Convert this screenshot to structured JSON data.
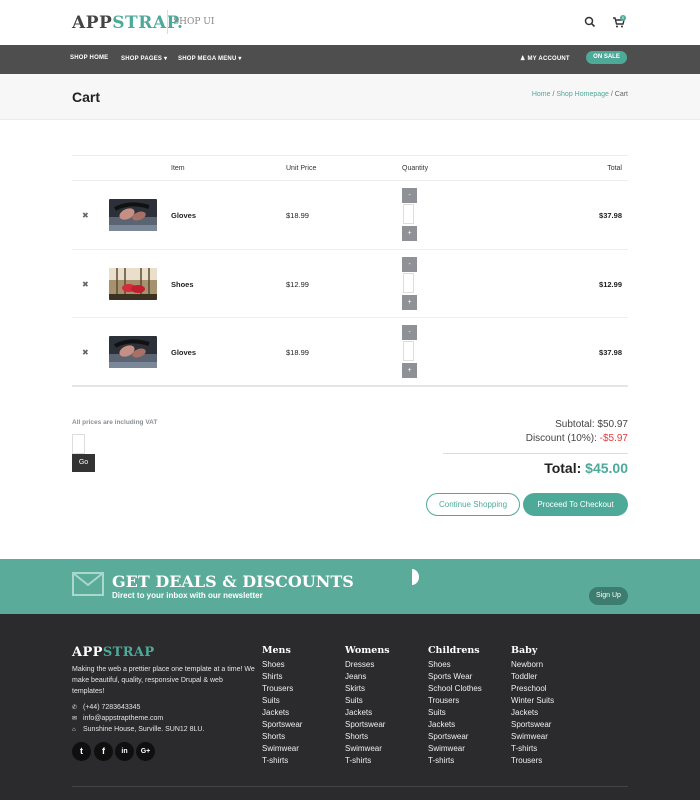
{
  "header": {
    "logo_part1": "APP",
    "logo_part2": "STRAP.",
    "subtitle": "SHOP UI",
    "cart_count": "0"
  },
  "nav": {
    "items": [
      "SHOP HOME",
      "SHOP PAGES ▾",
      "SHOP MEGA MENU ▾"
    ],
    "account": "MY ACCOUNT",
    "on_sale": "ON SALE"
  },
  "page": {
    "title": "Cart",
    "breadcrumb": [
      "Home",
      "Shop Homepage",
      "Cart"
    ]
  },
  "cart": {
    "columns": [
      "Item",
      "Unit Price",
      "Quantity",
      "Total"
    ],
    "rows": [
      {
        "name": "Gloves",
        "price": "$18.99",
        "total": "$37.98",
        "image": "gloves"
      },
      {
        "name": "Shoes",
        "price": "$12.99",
        "total": "$12.99",
        "image": "shoes"
      },
      {
        "name": "Gloves",
        "price": "$18.99",
        "total": "$37.98",
        "image": "gloves"
      }
    ],
    "minus": "-",
    "plus": "+",
    "remove_icon": "✖"
  },
  "summary": {
    "vat_note": "All prices are including VAT",
    "go": "Go",
    "subtotal_label": "Subtotal:",
    "subtotal": "$50.97",
    "discount_label": "Discount (10%):",
    "discount": "-$5.97",
    "total_label": "Total:",
    "total": "$45.00",
    "continue": "Continue Shopping",
    "checkout": "Proceed To Checkout"
  },
  "newsletter": {
    "heading": "GET DEALS & DISCOUNTS",
    "sub": "Direct to your inbox with our newsletter",
    "signup": "Sign Up"
  },
  "footer": {
    "logo_part1": "APP",
    "logo_part2": "STRAP",
    "description": "Making the web a prettier place one template at a time! We make beautiful, quality, responsive Drupal & web templates!",
    "phone": "(+44) 7283643345",
    "email": "info@appstraptheme.com",
    "address": "Sunshine House, Surville. SUN12 8LU.",
    "social": [
      "t",
      "f",
      "in",
      "G+"
    ],
    "columns": [
      {
        "heading": "Mens",
        "links": [
          "Shoes",
          "Shirts",
          "Trousers",
          "Suits",
          "Jackets",
          "Sportswear",
          "Shorts",
          "Swimwear",
          "T-shirts"
        ]
      },
      {
        "heading": "Womens",
        "links": [
          "Dresses",
          "Jeans",
          "Skirts",
          "Suits",
          "Jackets",
          "Sportswear",
          "Shorts",
          "Swimwear",
          "T-shirts"
        ]
      },
      {
        "heading": "Childrens",
        "links": [
          "Shoes",
          "Sports Wear",
          "School Clothes",
          "Trousers",
          "Suits",
          "Jackets",
          "Sportswear",
          "Swimwear",
          "T-shirts"
        ]
      },
      {
        "heading": "Baby",
        "links": [
          "Newborn",
          "Toddler",
          "Preschool",
          "Winter Suits",
          "Jackets",
          "Sportswear",
          "Swimwear",
          "T-shirts",
          "Trousers"
        ]
      }
    ]
  },
  "colors": {
    "accent": "#4daa99",
    "nav": "#4e4e4e",
    "footer": "#2b2b2d",
    "discount": "#e23b3b"
  }
}
